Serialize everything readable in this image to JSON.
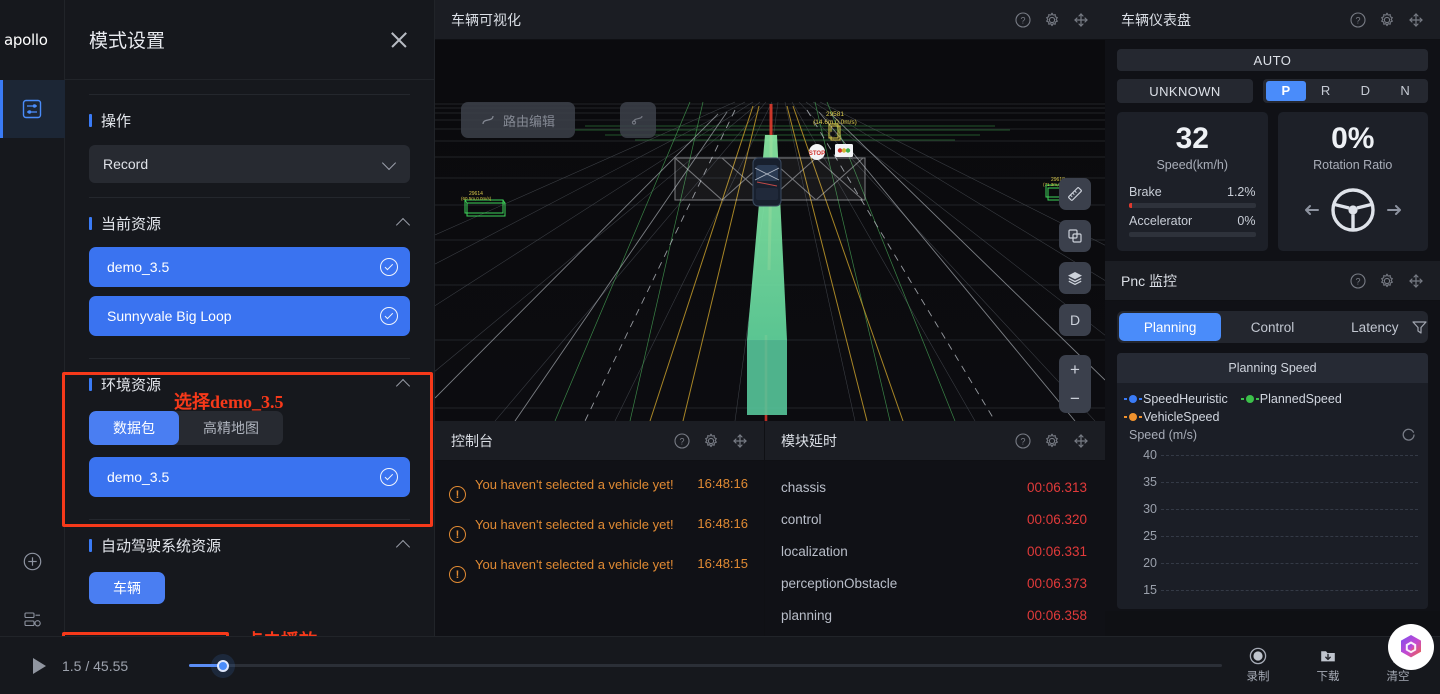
{
  "brand": {
    "logo_text": "apollo"
  },
  "rail": {
    "items": [
      {
        "name": "mode-settings",
        "icon": "sliders-icon",
        "active": true
      },
      {
        "name": "add-panel",
        "icon": "plus-circle-icon",
        "active": false
      },
      {
        "name": "resource-manager",
        "icon": "server-settings-icon",
        "active": false
      }
    ],
    "avatar_label": "user-avatar"
  },
  "mode_panel": {
    "title": "模式设置",
    "close_label": "×",
    "operation": {
      "section_title": "操作",
      "selected": "Record"
    },
    "current_resource": {
      "section_title": "当前资源",
      "items": [
        {
          "label": "demo_3.5",
          "selected": true
        },
        {
          "label": "Sunnyvale Big Loop",
          "selected": true
        }
      ]
    },
    "env_resource": {
      "section_title": "环境资源",
      "tabs": [
        {
          "label": "数据包",
          "active": true
        },
        {
          "label": "高精地图",
          "active": false
        }
      ],
      "items": [
        {
          "label": "demo_3.5",
          "selected": true
        }
      ]
    },
    "ads_resource": {
      "section_title": "自动驾驶系统资源",
      "items": [
        {
          "label": "车辆",
          "selected": true
        }
      ]
    }
  },
  "annotations": [
    {
      "text": "选择demo_3.5",
      "color": "#f6391a"
    },
    {
      "text": "点击播放",
      "color": "#f6391a"
    }
  ],
  "viz": {
    "title": "车辆可视化",
    "route_edit_label": "路由编辑",
    "tools": [
      {
        "name": "ruler-icon"
      },
      {
        "name": "copy-icon"
      },
      {
        "name": "layers-icon"
      },
      {
        "name": "gear-letter-d",
        "label": "D"
      }
    ],
    "zoom": {
      "plus": "+",
      "minus": "−"
    },
    "obstacle_labels": [
      {
        "id": "29581",
        "info": "(14.6m,0.0m/s)"
      }
    ]
  },
  "console": {
    "title": "控制台",
    "rows": [
      {
        "level": "warning",
        "message": "You haven't selected a vehicle yet!",
        "time": "16:48:16"
      },
      {
        "level": "warning",
        "message": "You haven't selected a vehicle yet!",
        "time": "16:48:16"
      },
      {
        "level": "warning",
        "message": "You haven't selected a vehicle yet!",
        "time": "16:48:15"
      }
    ]
  },
  "module_delay": {
    "title": "模块延时",
    "rows": [
      {
        "name": "chassis",
        "value": "00:06.313"
      },
      {
        "name": "control",
        "value": "00:06.320"
      },
      {
        "name": "localization",
        "value": "00:06.331"
      },
      {
        "name": "perceptionObstacle",
        "value": "00:06.373"
      },
      {
        "name": "planning",
        "value": "00:06.358"
      }
    ]
  },
  "dashboard": {
    "title": "车辆仪表盘",
    "drive_mode": "AUTO",
    "signal_status": "UNKNOWN",
    "gears": [
      {
        "label": "P",
        "active": true
      },
      {
        "label": "R",
        "active": false
      },
      {
        "label": "D",
        "active": false
      },
      {
        "label": "N",
        "active": false
      }
    ],
    "speed": {
      "value": "32",
      "label": "Speed(km/h)"
    },
    "rotation": {
      "value": "0%",
      "label": "Rotation Ratio"
    },
    "brake": {
      "label": "Brake",
      "value": "1.2%",
      "percent": 2
    },
    "accelerator": {
      "label": "Accelerator",
      "value": "0%",
      "percent": 0
    }
  },
  "pnc": {
    "title": "Pnc 监控",
    "tabs": [
      {
        "label": "Planning",
        "active": true
      },
      {
        "label": "Control",
        "active": false
      },
      {
        "label": "Latency",
        "active": false
      }
    ],
    "filter_icon": "filter-icon"
  },
  "chart_data": {
    "type": "line",
    "title": "Planning Speed",
    "ylabel": "Speed (m/s)",
    "xlabel": "",
    "ylim": [
      10,
      40
    ],
    "yticks": [
      40,
      35,
      30,
      25,
      20,
      15
    ],
    "grid": true,
    "legend_position": "top-left",
    "series": [
      {
        "name": "SpeedHeuristic",
        "color": "#3a7bf6",
        "values": []
      },
      {
        "name": "PlannedSpeed",
        "color": "#3cc04a",
        "values": []
      },
      {
        "name": "VehicleSpeed",
        "color": "#f0922e",
        "values": []
      }
    ]
  },
  "bottom_bar": {
    "play_icon": "play-icon",
    "time_display": "1.5 / 45.55",
    "progress_percent": 3.3,
    "actions": [
      {
        "label": "录制",
        "icon": "record-icon"
      },
      {
        "label": "下载",
        "icon": "download-icon"
      },
      {
        "label": "清空",
        "icon": "clear-icon"
      }
    ]
  },
  "colors": {
    "accent_blue": "#4a8cfa",
    "selected_blue": "#3a73f0",
    "warning_orange": "#e08a33",
    "error_red": "#e13a3a",
    "annotation_red": "#f6391a",
    "panel_bg": "#16181d",
    "content_bg": "#101116"
  }
}
